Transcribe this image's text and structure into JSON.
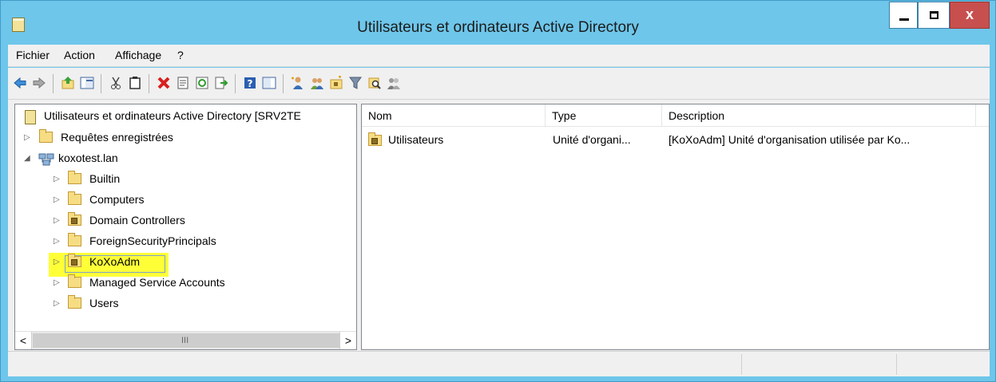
{
  "window": {
    "title": "Utilisateurs et ordinateurs Active Directory",
    "close_glyph": "x"
  },
  "menu": [
    "Fichier",
    "Action",
    "Affichage",
    "?"
  ],
  "toolbar": {
    "icons": [
      "back-arrow-icon",
      "forward-arrow-icon",
      "up-folder-icon",
      "show-console-tree-icon",
      "cut-icon",
      "copy-icon",
      "delete-icon",
      "properties-icon",
      "refresh-icon",
      "export-list-icon",
      "help-icon",
      "action-pane-icon",
      "new-user-icon",
      "new-group-icon",
      "new-ou-icon",
      "filter-icon",
      "find-icon",
      "add-to-group-icon"
    ]
  },
  "tree": {
    "root": "Utilisateurs et ordinateurs Active Directory [SRV2TE",
    "saved_queries": "Requêtes enregistrées",
    "domain": "koxotest.lan",
    "children": [
      "Builtin",
      "Computers",
      "Domain Controllers",
      "ForeignSecurityPrincipals",
      "KoXoAdm",
      "Managed Service Accounts",
      "Users"
    ],
    "selected": "KoXoAdm",
    "highlight_color": "#ffff38"
  },
  "scroll": {
    "left": "<",
    "right": ">",
    "grip": "III"
  },
  "list": {
    "columns": [
      "Nom",
      "Type",
      "Description"
    ],
    "rows": [
      {
        "name": "Utilisateurs",
        "type": "Unité d'organi...",
        "description": "[KoXoAdm] Unité d'organisation utilisée par Ko..."
      }
    ]
  },
  "colors": {
    "title_bar": "#6ec6ea",
    "close_button": "#c7504e",
    "pane_background": "#f0f0f0"
  }
}
